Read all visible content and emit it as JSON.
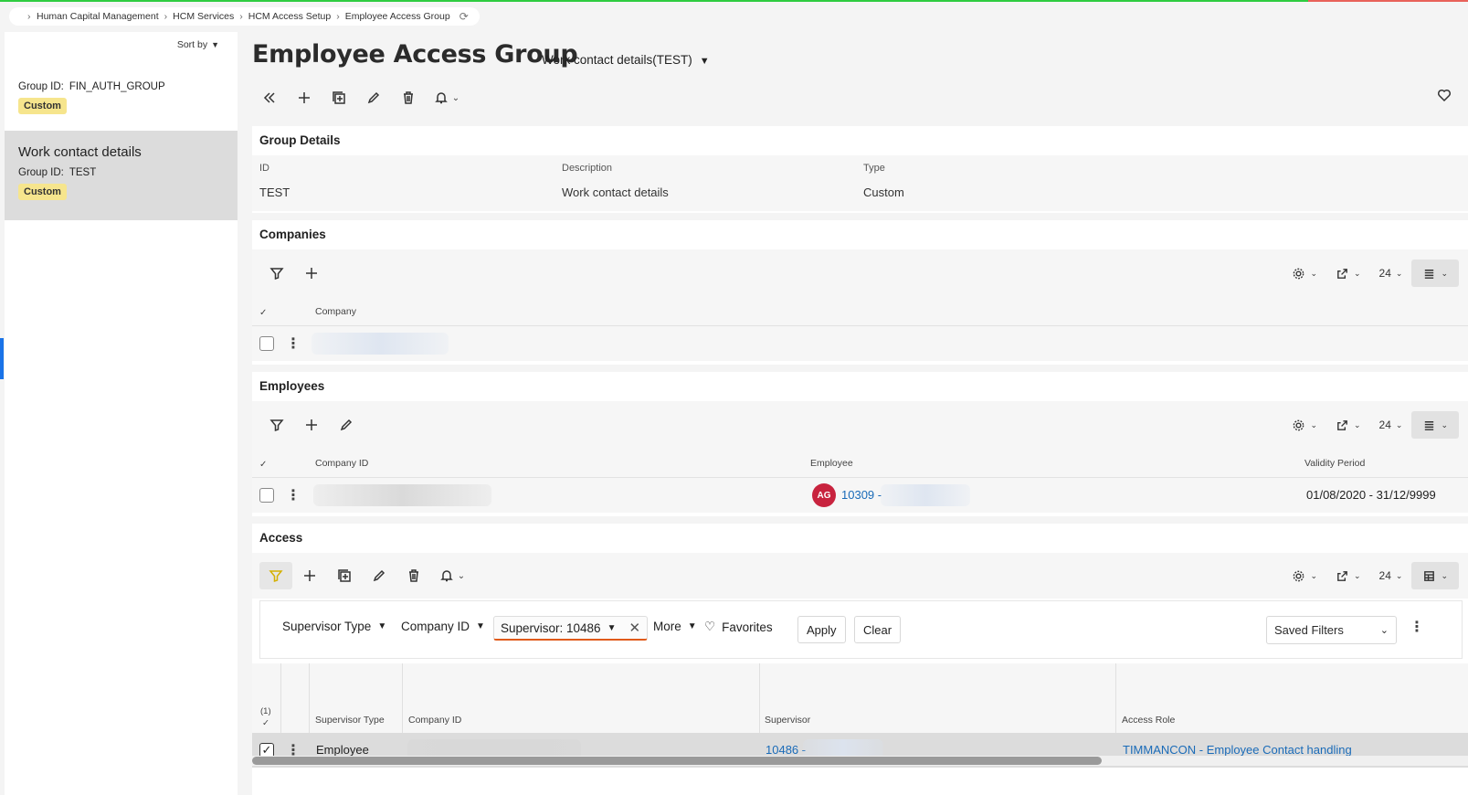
{
  "breadcrumb": {
    "items": [
      "Human Capital Management",
      "HCM Services",
      "HCM Access Setup",
      "Employee Access Group"
    ]
  },
  "sidebar": {
    "sort_label": "Sort by",
    "items": [
      {
        "name": "",
        "gid_label": "Group ID:",
        "gid_value": "FIN_AUTH_GROUP",
        "badge": "Custom"
      },
      {
        "name": "Work contact details",
        "gid_label": "Group ID:",
        "gid_value": "TEST",
        "badge": "Custom"
      }
    ]
  },
  "page": {
    "title": "Employee Access Group",
    "subtitle": "Work contact details(TEST)"
  },
  "group_details": {
    "title": "Group Details",
    "fields": [
      {
        "label": "ID",
        "value": "TEST"
      },
      {
        "label": "Description",
        "value": "Work contact details"
      },
      {
        "label": "Type",
        "value": "Custom"
      }
    ]
  },
  "companies": {
    "title": "Companies",
    "page_size": "24",
    "columns": [
      "Company"
    ]
  },
  "employees": {
    "title": "Employees",
    "page_size": "24",
    "columns": [
      "Company ID",
      "Employee",
      "Validity Period"
    ],
    "row": {
      "avatar": "AG",
      "employee": "10309 -",
      "validity": "01/08/2020 - 31/12/9999"
    }
  },
  "access": {
    "title": "Access",
    "page_size": "24",
    "filters": {
      "supervisor_type": "Supervisor Type",
      "company_id": "Company ID",
      "supervisor": "Supervisor: 10486",
      "more": "More",
      "favorites": "Favorites",
      "apply": "Apply",
      "clear": "Clear",
      "saved_filters": "Saved Filters"
    },
    "selected_count": "(1)",
    "columns": [
      "Supervisor Type",
      "Company ID",
      "Supervisor",
      "Access Role"
    ],
    "row": {
      "supervisor_type": "Employee",
      "supervisor": "10486 -",
      "access_role": "TIMMANCON - Employee Contact handling"
    }
  },
  "colors": {
    "accent": "#1a6bb8",
    "badge": "#f6e58d",
    "avatar": "#c8233e",
    "active_filter": "#e05a1a"
  }
}
